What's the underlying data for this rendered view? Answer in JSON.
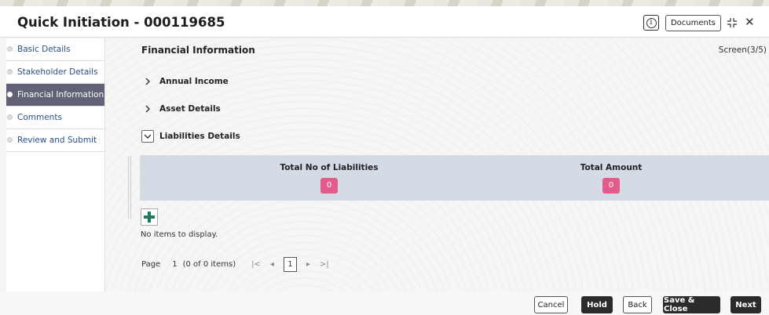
{
  "header": {
    "title": "Quick Initiation - 000119685",
    "info_icon": "info-circle-icon",
    "documents_label": "Documents",
    "expand_icon": "expand-icon",
    "close_icon": "close-icon",
    "close_glyph": "✕"
  },
  "sidebar": {
    "items": [
      {
        "label": "Basic Details",
        "active": false
      },
      {
        "label": "Stakeholder Details",
        "active": false
      },
      {
        "label": "Financial Information",
        "active": true
      },
      {
        "label": "Comments",
        "active": false
      },
      {
        "label": "Review and Submit",
        "active": false
      }
    ]
  },
  "main": {
    "section_title": "Financial Information",
    "screen_indicator": "Screen(3/5)",
    "accordions": [
      {
        "label": "Annual Income",
        "expanded": false
      },
      {
        "label": "Asset Details",
        "expanded": false
      },
      {
        "label": "Liabilities Details",
        "expanded": true
      }
    ],
    "summary": {
      "total_no_label": "Total No of Liabilities",
      "total_no_value": "0",
      "total_amount_label": "Total Amount",
      "total_amount_value": "0"
    },
    "add_icon": "plus-icon",
    "empty_message": "No items to display.",
    "pagination": {
      "page_label": "Page",
      "page_number": "1",
      "item_count": "(0 of 0 items)",
      "current_page": "1",
      "first_glyph": "|<",
      "prev_glyph": "◂",
      "next_glyph": "▸",
      "last_glyph": ">|"
    }
  },
  "footer": {
    "cancel": "Cancel",
    "hold": "Hold",
    "back": "Back",
    "save_close": "Save & Close",
    "next": "Next"
  },
  "colors": {
    "active_nav": "#616178",
    "summary_band": "#d5dbe5",
    "badge": "#e25b8a",
    "add_icon": "#1a7a5a",
    "dark_button": "#2b2b2b"
  }
}
